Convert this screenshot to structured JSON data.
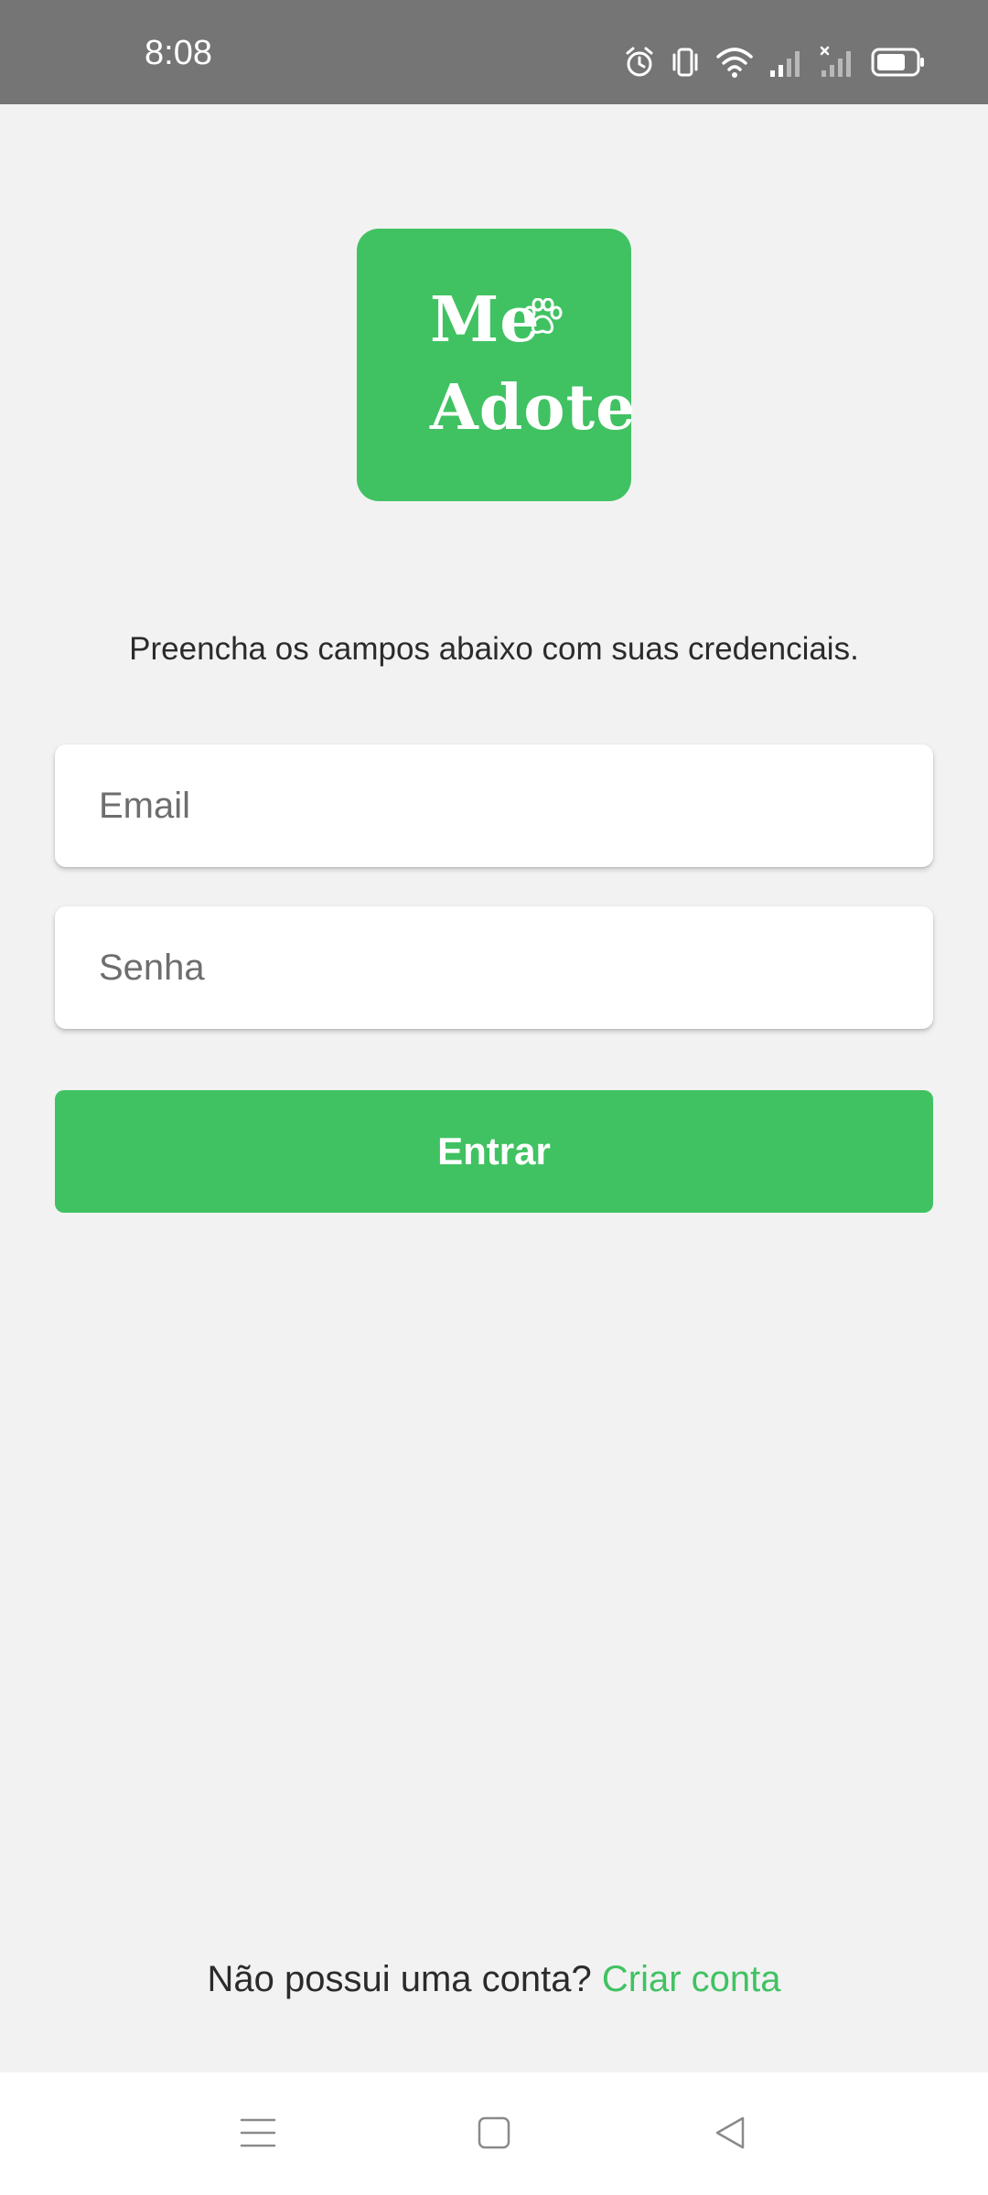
{
  "status_bar": {
    "time": "8:08",
    "icons": [
      "alarm-icon",
      "vibrate-icon",
      "wifi-icon",
      "signal-icon",
      "signal-no-service-icon",
      "battery-icon"
    ]
  },
  "logo": {
    "line1": "Me",
    "line2": "Adote",
    "icon": "paw-icon"
  },
  "login": {
    "instruction": "Preencha os campos abaixo com suas credenciais.",
    "email_placeholder": "Email",
    "password_placeholder": "Senha",
    "submit_label": "Entrar"
  },
  "signup": {
    "prompt": "Não possui uma conta?",
    "link_label": "Criar conta"
  },
  "nav_bar": {
    "icons": [
      "menu-icon",
      "home-icon",
      "back-icon"
    ]
  },
  "colors": {
    "brand_green": "#40c262",
    "status_bar": "#757575",
    "background": "#f2f2f2",
    "text": "#2b2b2b"
  }
}
